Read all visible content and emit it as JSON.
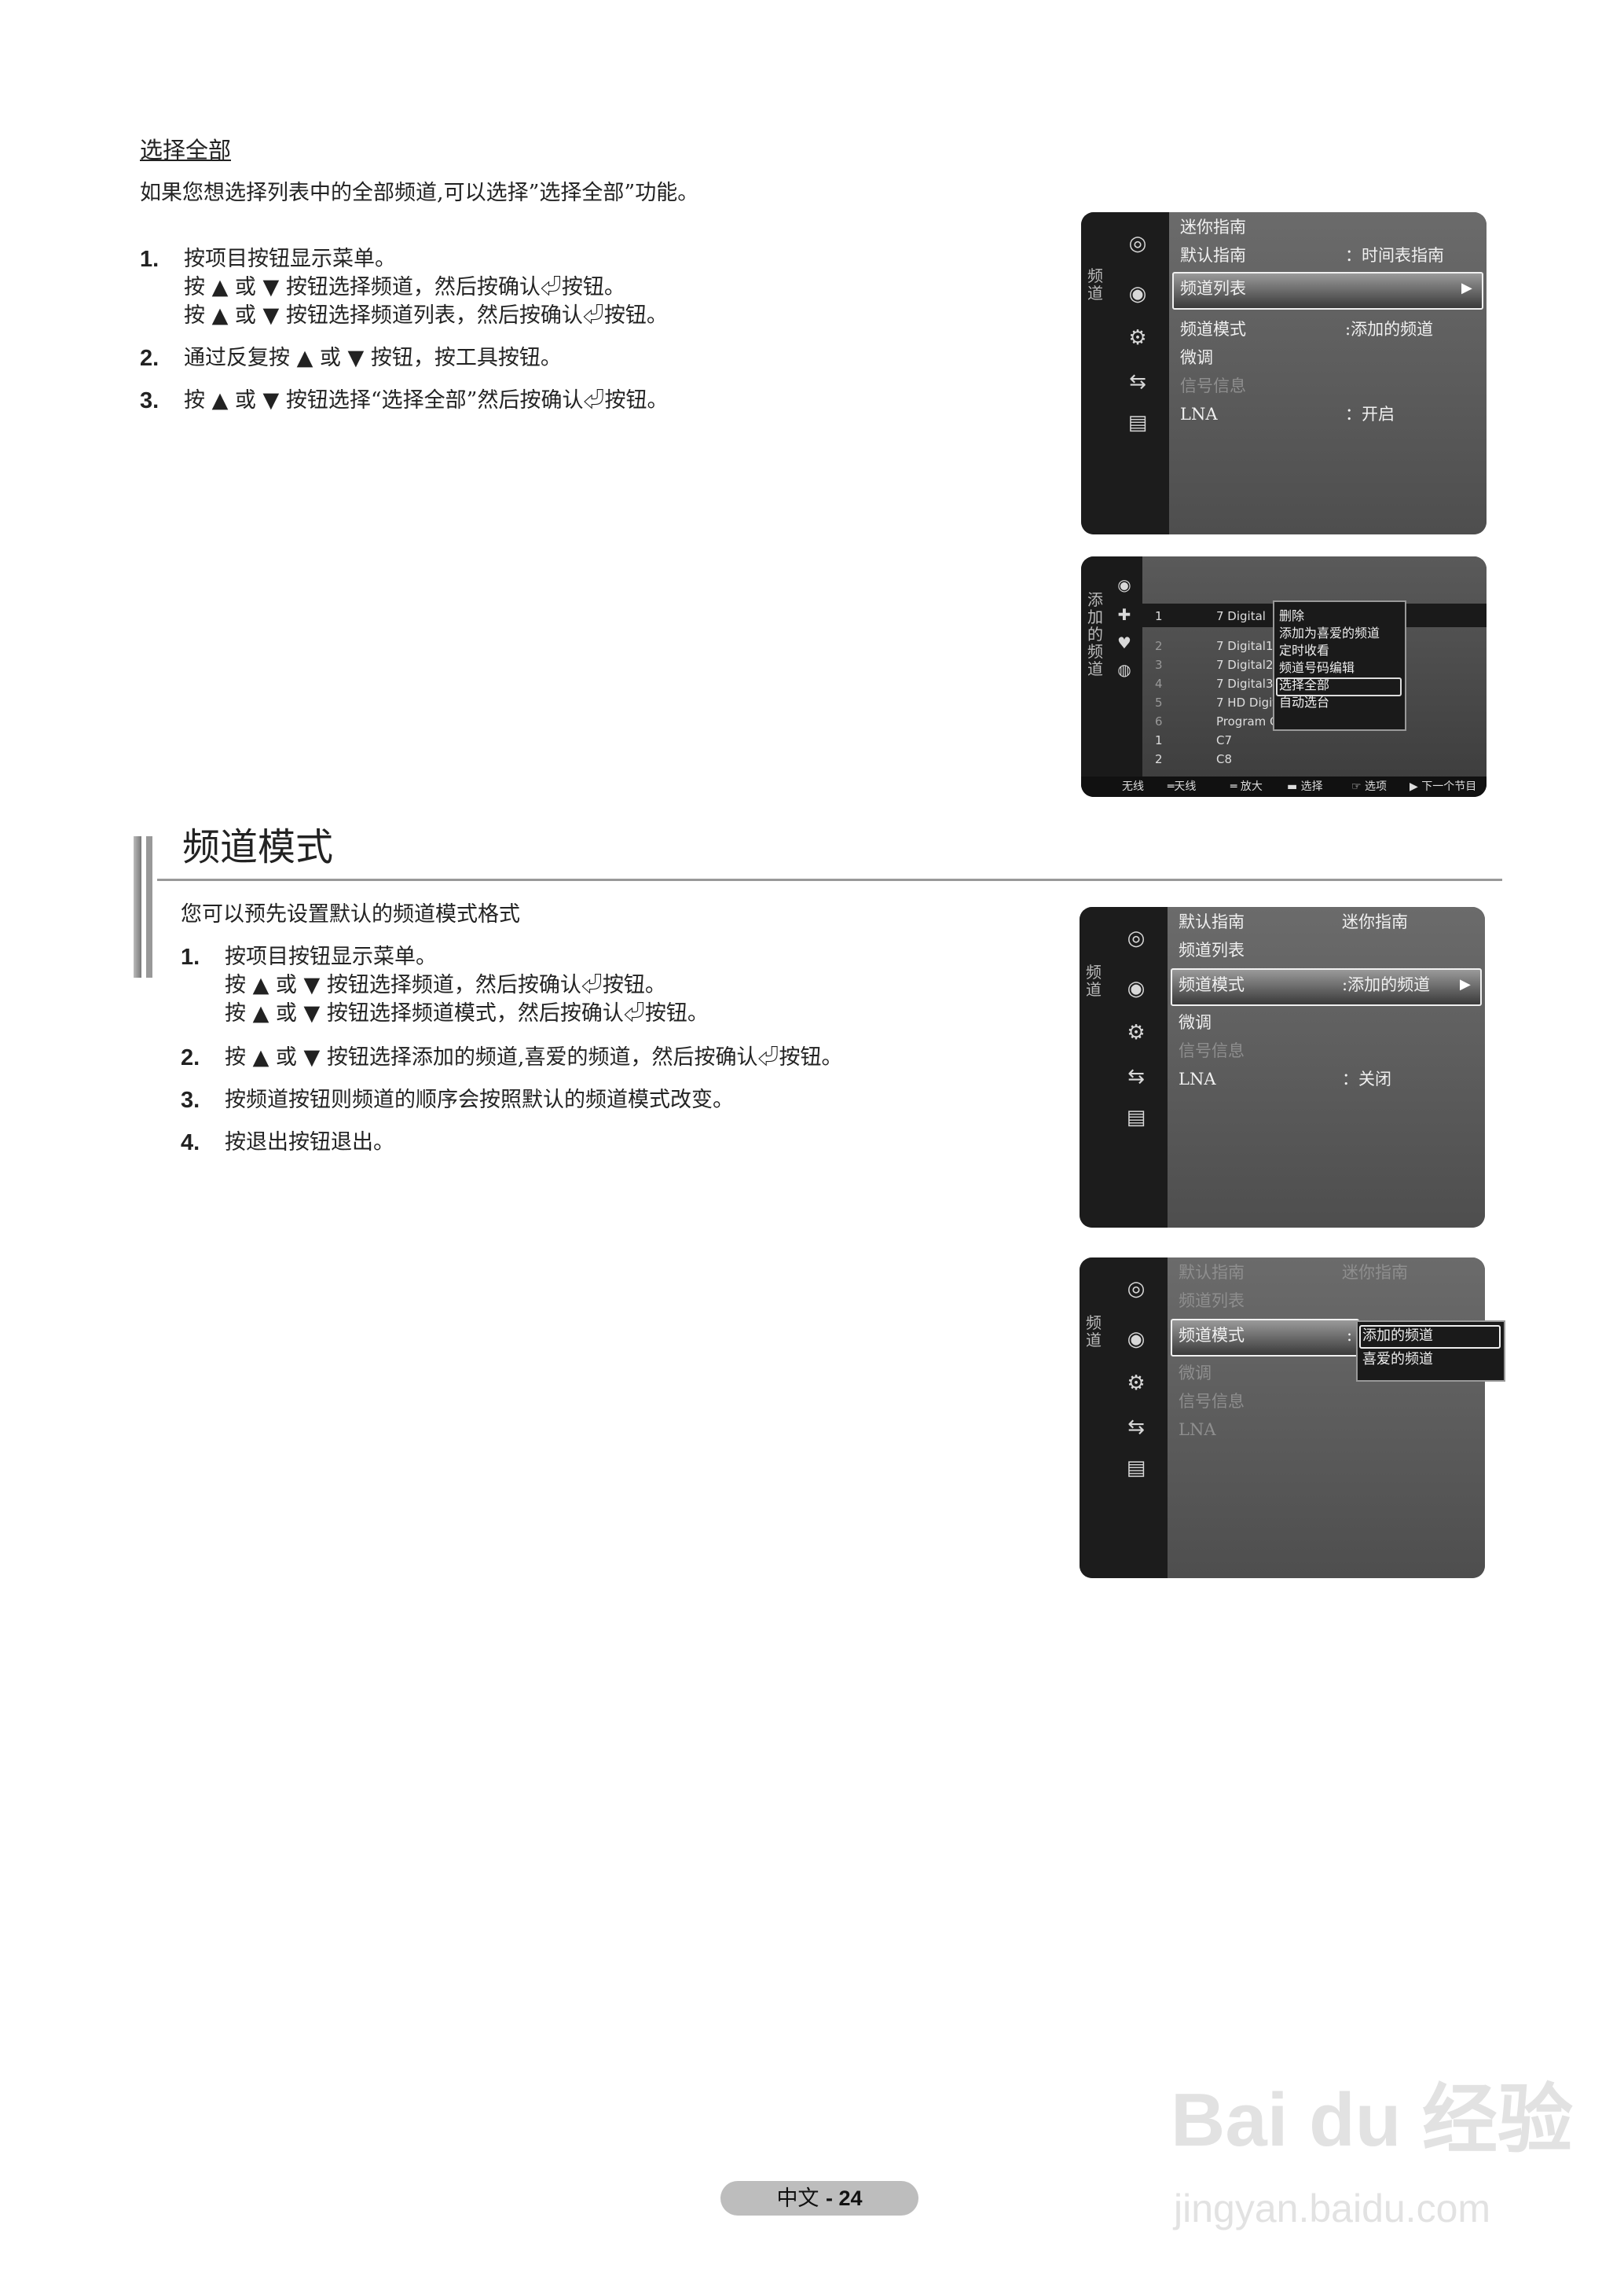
{
  "section1": {
    "title": "选择全部",
    "intro": "如果您想选择列表中的全部频道,可以选择”选择全部”功能。",
    "steps": [
      {
        "num": "1.",
        "lines": [
          "按项目按钮显示菜单。",
          "按 ▲ 或 ▼ 按钮选择频道，然后按确认⏎按钮。",
          "按 ▲ 或 ▼ 按钮选择频道列表，然后按确认⏎按钮。"
        ]
      },
      {
        "num": "2.",
        "lines": [
          "通过反复按 ▲ 或 ▼ 按钮，按工具按钮。"
        ]
      },
      {
        "num": "3.",
        "lines": [
          "按 ▲ 或 ▼ 按钮选择“选择全部”然后按确认⏎按钮。"
        ]
      }
    ]
  },
  "section2": {
    "title": "频道模式",
    "intro": "您可以预先设置默认的频道模式格式",
    "steps": [
      {
        "num": "1.",
        "lines": [
          "按项目按钮显示菜单。",
          "按 ▲ 或 ▼ 按钮选择频道，然后按确认⏎按钮。",
          "按 ▲ 或 ▼ 按钮选择频道模式，然后按确认⏎按钮。"
        ]
      },
      {
        "num": "2.",
        "lines": [
          "按 ▲ 或 ▼ 按钮选择添加的频道,喜爱的频道，然后按确认⏎按钮。"
        ]
      },
      {
        "num": "3.",
        "lines": [
          "按频道按钮则频道的顺序会按照默认的频道模式改变。"
        ]
      },
      {
        "num": "4.",
        "lines": [
          "按退出按钮退出。"
        ]
      }
    ]
  },
  "screen1": {
    "side_label": "频\n道",
    "items": [
      {
        "label": "迷你指南",
        "value": ""
      },
      {
        "label": "默认指南",
        "value": "：时间表指南"
      },
      {
        "label": "频道列表",
        "value": ""
      },
      {
        "label": "频道模式",
        "value": ":添加的频道"
      },
      {
        "label": "微调",
        "value": ""
      },
      {
        "label": "信号信息",
        "value": ""
      },
      {
        "label": "LNA",
        "value": "：开启"
      }
    ]
  },
  "screen2": {
    "side_label": "添\n加\n的\n频\n道",
    "channels": [
      {
        "num": "1",
        "name": "7 Digital"
      },
      {
        "num": "2",
        "name": "7 Digital1"
      },
      {
        "num": "3",
        "name": "7 Digital2"
      },
      {
        "num": "4",
        "name": "7 Digital3"
      },
      {
        "num": "5",
        "name": "7 HD Digital"
      },
      {
        "num": "6",
        "name": "Program Guide"
      },
      {
        "num": "1",
        "name": "C7"
      },
      {
        "num": "2",
        "name": "C8"
      }
    ],
    "popup": [
      "删除",
      "添加为喜爱的频道",
      "定时收看",
      "频道号码编辑",
      "选择全部",
      "自动选台"
    ],
    "footer": [
      "无线",
      "═天线",
      "═ 放大",
      "▬ 选择",
      "☞ 选项",
      "▶ 下一个节目"
    ]
  },
  "screen3": {
    "side_label": "频\n道",
    "items": [
      {
        "label": "默认指南",
        "value": "迷你指南"
      },
      {
        "label": "频道列表",
        "value": ""
      },
      {
        "label": "频道模式",
        "value": ":添加的频道"
      },
      {
        "label": "微调",
        "value": ""
      },
      {
        "label": "信号信息",
        "value": ""
      },
      {
        "label": "LNA",
        "value": "：关闭"
      }
    ]
  },
  "screen4": {
    "side_label": "频\n道",
    "items": [
      {
        "label": "默认指南",
        "value": "迷你指南"
      },
      {
        "label": "频道列表",
        "value": ""
      },
      {
        "label": "频道模式",
        "value": ":"
      },
      {
        "label": "微调",
        "value": ""
      },
      {
        "label": "信号信息",
        "value": ""
      },
      {
        "label": "LNA",
        "value": ""
      }
    ],
    "popup": [
      "添加的频道",
      "喜爱的频道"
    ]
  },
  "footer": {
    "lang": "中文",
    "page": "- 24"
  },
  "watermark": {
    "line1": "Bai du 经验",
    "line2": "jingyan.baidu.com"
  }
}
